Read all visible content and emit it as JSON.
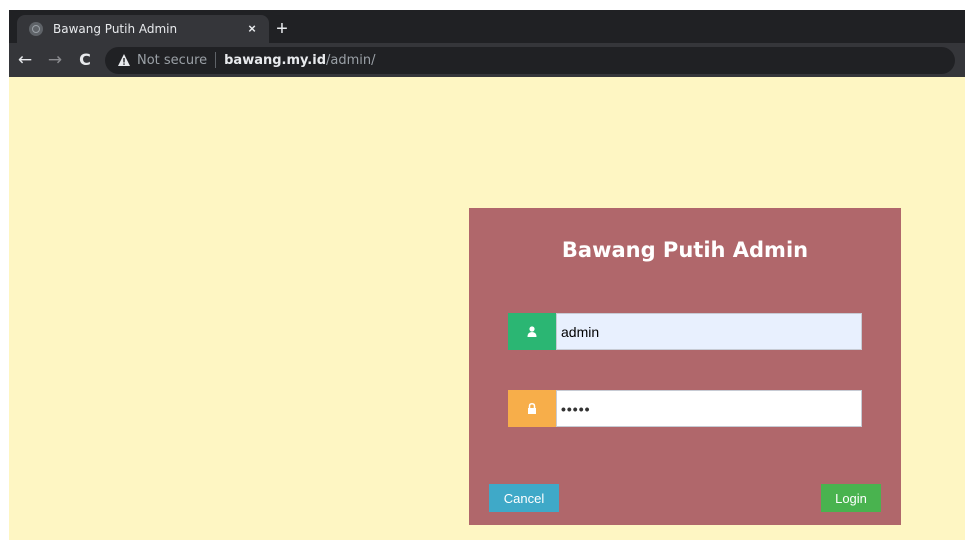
{
  "browser": {
    "tab": {
      "title": "Bawang Putih Admin",
      "close_glyph": "×",
      "favicon": "globe-icon"
    },
    "new_tab_glyph": "+",
    "nav": {
      "back": "←",
      "forward": "→",
      "reload": "C"
    },
    "address": {
      "security_label": "Not secure",
      "host": "bawang.my.id",
      "path": "/admin/"
    }
  },
  "login": {
    "title": "Bawang Putih Admin",
    "username": {
      "value": "admin",
      "icon": "user-icon"
    },
    "password": {
      "value": "•••••",
      "icon": "lock-icon"
    },
    "cancel_label": "Cancel",
    "login_label": "Login"
  },
  "colors": {
    "page_background": "#fef6c3",
    "panel_background": "#b0676b",
    "user_addon": "#2bb673",
    "password_addon": "#f7ae4a",
    "cancel_button": "#3fa9c8",
    "login_button": "#49b34f"
  }
}
